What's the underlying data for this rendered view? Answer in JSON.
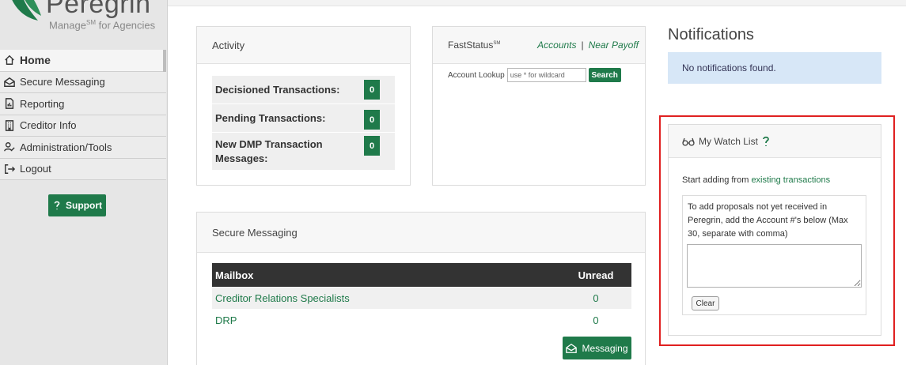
{
  "brand": {
    "name": "Peregrin",
    "tagline_prefix": "Manage",
    "tagline_mark": "SM",
    "tagline_suffix": " for Agencies",
    "color": "#1f7a4a"
  },
  "sidebar": {
    "items": [
      {
        "label": "Home",
        "icon": "home-icon"
      },
      {
        "label": "Secure Messaging",
        "icon": "envelope-icon"
      },
      {
        "label": "Reporting",
        "icon": "report-icon"
      },
      {
        "label": "Creditor Info",
        "icon": "building-icon"
      },
      {
        "label": "Administration/Tools",
        "icon": "user-tools-icon"
      },
      {
        "label": "Logout",
        "icon": "logout-icon"
      }
    ],
    "support_label": "Support"
  },
  "activity": {
    "title": "Activity",
    "rows": [
      {
        "label": "Decisioned Transactions:",
        "count": "0"
      },
      {
        "label": "Pending Transactions:",
        "count": "0"
      },
      {
        "label": "New DMP Transaction Messages:",
        "count": "0"
      }
    ]
  },
  "fast_status": {
    "title": "FastStatus",
    "title_mark": "SM",
    "link_accounts": "Accounts",
    "link_separator": "|",
    "link_near_payoff": "Near Payoff",
    "lookup_label": "Account Lookup",
    "lookup_placeholder": "use * for wildcard",
    "search_label": "Search"
  },
  "secure_messaging": {
    "title": "Secure Messaging",
    "columns": [
      "Mailbox",
      "Unread"
    ],
    "rows": [
      {
        "mailbox": "Creditor Relations Specialists",
        "unread": "0"
      },
      {
        "mailbox": "DRP",
        "unread": "0"
      }
    ],
    "button_label": "Messaging"
  },
  "notifications": {
    "title": "Notifications",
    "empty_text": "No notifications found."
  },
  "watch_list": {
    "title": "My Watch List",
    "start_text": "Start adding from ",
    "start_link": "existing transactions",
    "add_text": "To add proposals not yet received in Peregrin, add the Account #'s below (Max 30, separate with comma)",
    "account_value": "",
    "clear_label": "Clear"
  },
  "highlight_color": "#e02020"
}
